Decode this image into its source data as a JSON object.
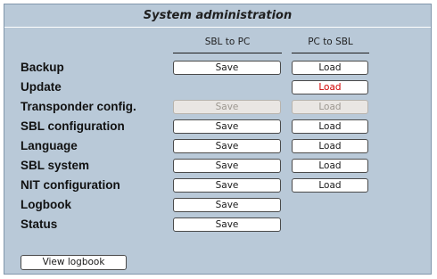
{
  "title": "System administration",
  "columns": {
    "sbl_to_pc": "SBL to PC",
    "pc_to_sbl": "PC to SBL"
  },
  "rows": [
    {
      "label": "Backup",
      "save": "Save",
      "load": "Load"
    },
    {
      "label": "Update",
      "load": "Load"
    },
    {
      "label": "Transponder config.",
      "save": "Save",
      "load": "Load"
    },
    {
      "label": "SBL configuration",
      "save": "Save",
      "load": "Load"
    },
    {
      "label": "Language",
      "save": "Save",
      "load": "Load"
    },
    {
      "label": "SBL system",
      "save": "Save",
      "load": "Load"
    },
    {
      "label": "NIT configuration",
      "save": "Save",
      "load": "Load"
    },
    {
      "label": "Logbook",
      "save": "Save"
    },
    {
      "label": "Status",
      "save": "Save"
    }
  ],
  "view_logbook_button": "View logbook",
  "colors": {
    "panel_background": "#b9c9d8",
    "update_load_text": "#d10000",
    "disabled_text": "#9c9790"
  }
}
